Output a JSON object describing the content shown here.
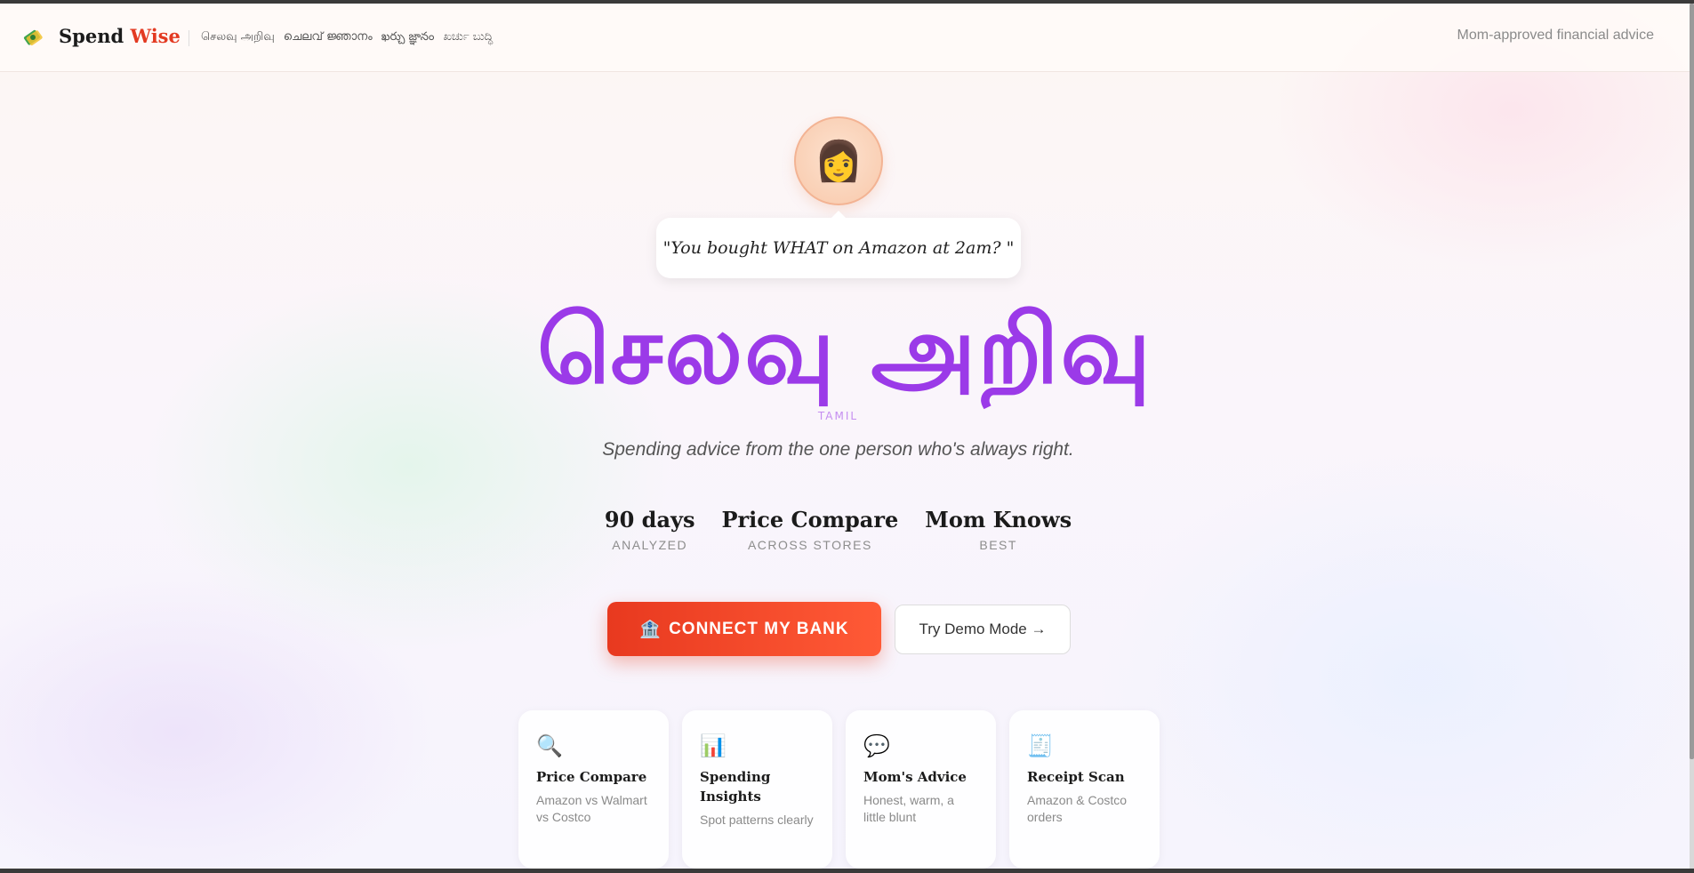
{
  "nav": {
    "brand_part1": "Spend",
    "brand_part2": "Wise",
    "languages": [
      "செலவு அறிவு",
      "ചെലവ് ജ്ഞാനം",
      "ఖర్చు జ్ఞానం",
      "ಖರ್ಚು ಬುದ್ಧಿ"
    ],
    "tagline": "Mom-approved financial advice"
  },
  "hero": {
    "avatar_emoji": "👩",
    "quote": "\"You bought WHAT on Amazon at 2am? \"",
    "title": "செலவு அறிவு",
    "language_tag": "TAMIL",
    "subtitle": "Spending advice from the one person who's always right."
  },
  "stats": [
    {
      "value": "90 days",
      "label": "ANALYZED"
    },
    {
      "value": "Price Compare",
      "label": "ACROSS STORES"
    },
    {
      "value": "Mom Knows",
      "label": "BEST"
    }
  ],
  "actions": {
    "primary_icon": "🏦",
    "primary_label": "CONNECT MY BANK",
    "secondary_label": "Try Demo Mode →"
  },
  "features": [
    {
      "icon": "🔍",
      "icon_name": "magnifier-icon",
      "title": "Price Compare",
      "desc": "Amazon vs Walmart vs Costco"
    },
    {
      "icon": "📊",
      "icon_name": "bar-chart-icon",
      "title": "Spending Insights",
      "desc": "Spot patterns clearly"
    },
    {
      "icon": "💬",
      "icon_name": "speech-bubble-icon",
      "title": "Mom's Advice",
      "desc": "Honest, warm, a little blunt"
    },
    {
      "icon": "🧾",
      "icon_name": "receipt-icon",
      "title": "Receipt Scan",
      "desc": "Amazon & Costco orders"
    }
  ],
  "colors": {
    "accent": "#9b3ae8",
    "cta": "#e8391f",
    "brand_red": "#e33a22"
  }
}
